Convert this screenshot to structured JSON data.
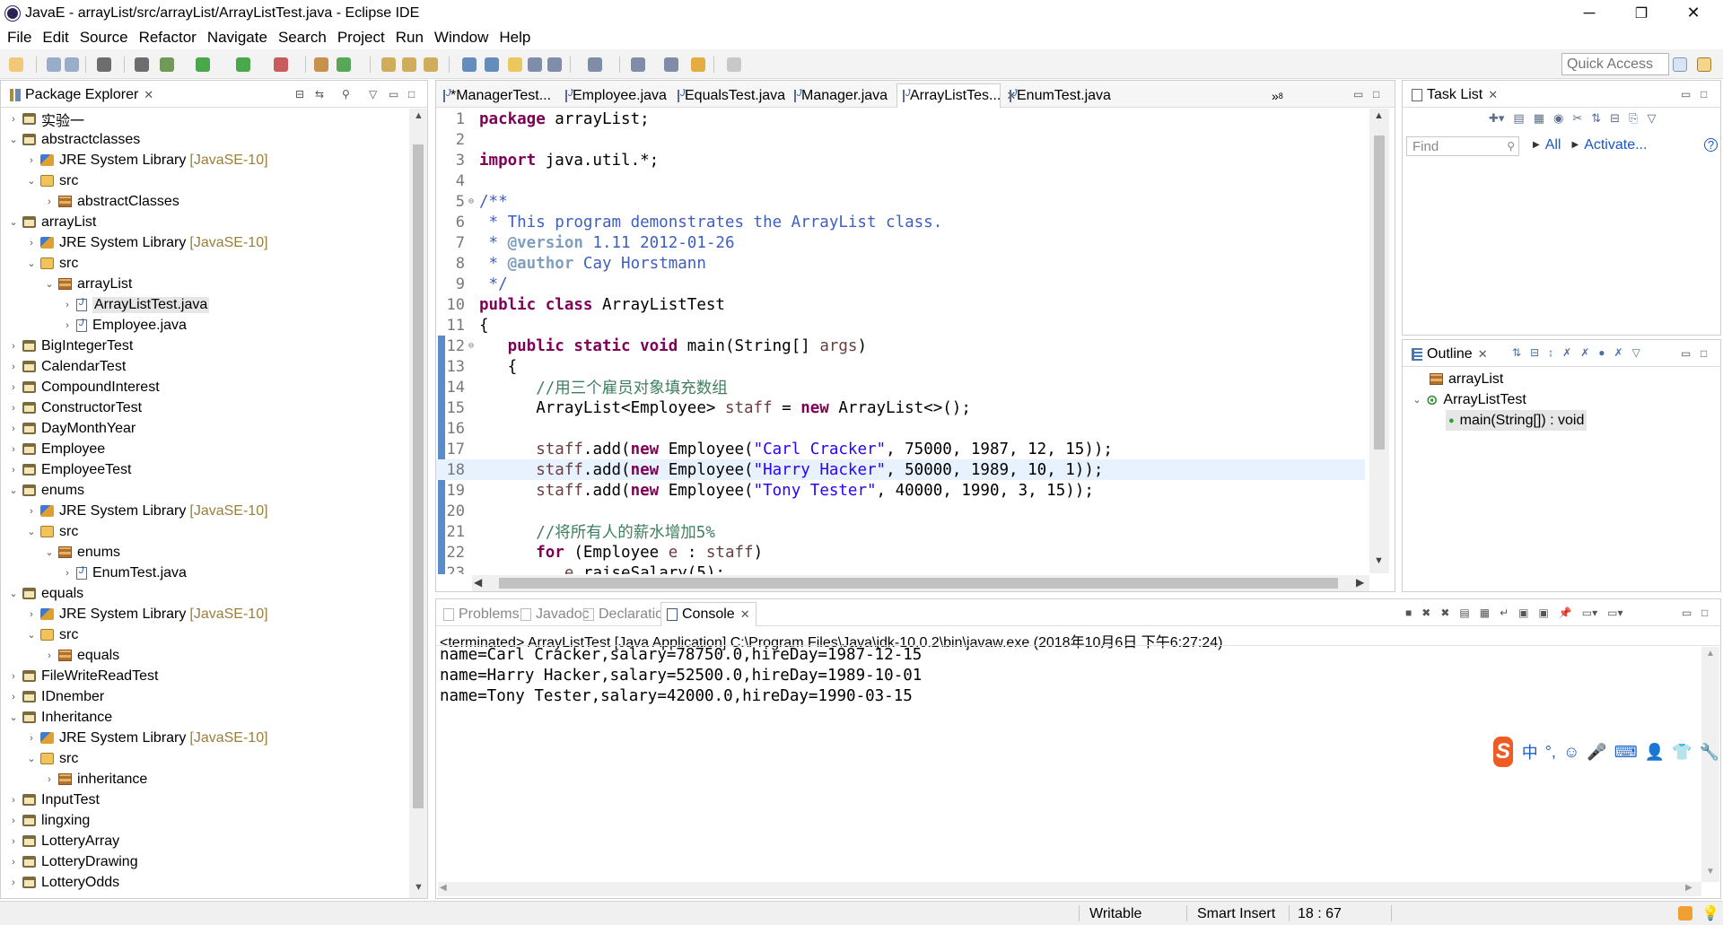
{
  "window": {
    "title": "JavaE - arrayList/src/arrayList/ArrayListTest.java - Eclipse IDE",
    "controls": {
      "minimize": "─",
      "restore": "❐",
      "close": "✕"
    }
  },
  "menu": [
    "File",
    "Edit",
    "Source",
    "Refactor",
    "Navigate",
    "Search",
    "Project",
    "Run",
    "Window",
    "Help"
  ],
  "toolbar": {
    "quick_access_placeholder": "Quick Access"
  },
  "package_explorer": {
    "title": "Package Explorer",
    "rows": [
      {
        "label": "实验一",
        "indent": 0,
        "expand": "›",
        "icon": "project",
        "extra": ""
      },
      {
        "label": "abstractclasses",
        "indent": 0,
        "expand": "⌄",
        "icon": "project",
        "extra": ""
      },
      {
        "label": "JRE System Library",
        "indent": 1,
        "expand": "›",
        "icon": "jre",
        "extra": "[JavaSE-10]"
      },
      {
        "label": "src",
        "indent": 1,
        "expand": "⌄",
        "icon": "src",
        "extra": ""
      },
      {
        "label": "abstractClasses",
        "indent": 2,
        "expand": "›",
        "icon": "pkg",
        "extra": ""
      },
      {
        "label": "arrayList",
        "indent": 0,
        "expand": "⌄",
        "icon": "project",
        "extra": ""
      },
      {
        "label": "JRE System Library",
        "indent": 1,
        "expand": "›",
        "icon": "jre",
        "extra": "[JavaSE-10]"
      },
      {
        "label": "src",
        "indent": 1,
        "expand": "⌄",
        "icon": "src",
        "extra": ""
      },
      {
        "label": "arrayList",
        "indent": 2,
        "expand": "⌄",
        "icon": "pkg",
        "extra": ""
      },
      {
        "label": "ArrayListTest.java",
        "indent": 3,
        "expand": "›",
        "icon": "java",
        "extra": "",
        "selected": true
      },
      {
        "label": "Employee.java",
        "indent": 3,
        "expand": "›",
        "icon": "java",
        "extra": ""
      },
      {
        "label": "BigIntegerTest",
        "indent": 0,
        "expand": "›",
        "icon": "project",
        "extra": ""
      },
      {
        "label": "CalendarTest",
        "indent": 0,
        "expand": "›",
        "icon": "project",
        "extra": ""
      },
      {
        "label": "CompoundInterest",
        "indent": 0,
        "expand": "›",
        "icon": "project",
        "extra": ""
      },
      {
        "label": "ConstructorTest",
        "indent": 0,
        "expand": "›",
        "icon": "project",
        "extra": ""
      },
      {
        "label": "DayMonthYear",
        "indent": 0,
        "expand": "›",
        "icon": "project",
        "extra": ""
      },
      {
        "label": "Employee",
        "indent": 0,
        "expand": "›",
        "icon": "project",
        "extra": ""
      },
      {
        "label": "EmployeeTest",
        "indent": 0,
        "expand": "›",
        "icon": "project",
        "extra": ""
      },
      {
        "label": "enums",
        "indent": 0,
        "expand": "⌄",
        "icon": "project",
        "extra": ""
      },
      {
        "label": "JRE System Library",
        "indent": 1,
        "expand": "›",
        "icon": "jre",
        "extra": "[JavaSE-10]"
      },
      {
        "label": "src",
        "indent": 1,
        "expand": "⌄",
        "icon": "src",
        "extra": ""
      },
      {
        "label": "enums",
        "indent": 2,
        "expand": "⌄",
        "icon": "pkg",
        "extra": ""
      },
      {
        "label": "EnumTest.java",
        "indent": 3,
        "expand": "›",
        "icon": "java",
        "extra": ""
      },
      {
        "label": "equals",
        "indent": 0,
        "expand": "⌄",
        "icon": "project",
        "extra": ""
      },
      {
        "label": "JRE System Library",
        "indent": 1,
        "expand": "›",
        "icon": "jre",
        "extra": "[JavaSE-10]"
      },
      {
        "label": "src",
        "indent": 1,
        "expand": "⌄",
        "icon": "src",
        "extra": ""
      },
      {
        "label": "equals",
        "indent": 2,
        "expand": "›",
        "icon": "pkg",
        "extra": ""
      },
      {
        "label": "FileWriteReadTest",
        "indent": 0,
        "expand": "›",
        "icon": "project",
        "extra": ""
      },
      {
        "label": "IDnember",
        "indent": 0,
        "expand": "›",
        "icon": "project",
        "extra": ""
      },
      {
        "label": "Inheritance",
        "indent": 0,
        "expand": "⌄",
        "icon": "project",
        "extra": ""
      },
      {
        "label": "JRE System Library",
        "indent": 1,
        "expand": "›",
        "icon": "jre",
        "extra": "[JavaSE-10]"
      },
      {
        "label": "src",
        "indent": 1,
        "expand": "⌄",
        "icon": "src",
        "extra": ""
      },
      {
        "label": "inheritance",
        "indent": 2,
        "expand": "›",
        "icon": "pkg",
        "extra": ""
      },
      {
        "label": "InputTest",
        "indent": 0,
        "expand": "›",
        "icon": "project",
        "extra": ""
      },
      {
        "label": "lingxing",
        "indent": 0,
        "expand": "›",
        "icon": "project",
        "extra": ""
      },
      {
        "label": "LotteryArray",
        "indent": 0,
        "expand": "›",
        "icon": "project",
        "extra": ""
      },
      {
        "label": "LotteryDrawing",
        "indent": 0,
        "expand": "›",
        "icon": "project",
        "extra": ""
      },
      {
        "label": "LotteryOdds",
        "indent": 0,
        "expand": "›",
        "icon": "project",
        "extra": ""
      }
    ]
  },
  "editor": {
    "tabs": [
      {
        "label": "*ManagerTest...",
        "active": false
      },
      {
        "label": "Employee.java",
        "active": false
      },
      {
        "label": "EqualsTest.java",
        "active": false
      },
      {
        "label": "Manager.java",
        "active": false
      },
      {
        "label": "ArrayListTes...",
        "active": true
      },
      {
        "label": "EnumTest.java",
        "active": false
      }
    ],
    "overflow_label": "»",
    "overflow_count": "8",
    "current_line": 18,
    "lines": [
      {
        "n": "1",
        "fold": "",
        "segs": [
          [
            "kw",
            "package"
          ],
          [
            "p",
            " arrayList;"
          ]
        ]
      },
      {
        "n": "2",
        "fold": "",
        "segs": []
      },
      {
        "n": "3",
        "fold": "",
        "segs": [
          [
            "kw",
            "import"
          ],
          [
            "p",
            " java.util.*;"
          ]
        ]
      },
      {
        "n": "4",
        "fold": "",
        "segs": []
      },
      {
        "n": "5",
        "fold": "⊖",
        "segs": [
          [
            "doc",
            "/**"
          ]
        ]
      },
      {
        "n": "6",
        "fold": "",
        "segs": [
          [
            "doc",
            " * This program demonstrates the ArrayList class."
          ]
        ]
      },
      {
        "n": "7",
        "fold": "",
        "segs": [
          [
            "doc",
            " * "
          ],
          [
            "tag",
            "@version"
          ],
          [
            "doc",
            " 1.11 2012-01-26"
          ]
        ]
      },
      {
        "n": "8",
        "fold": "",
        "segs": [
          [
            "doc",
            " * "
          ],
          [
            "tag",
            "@author"
          ],
          [
            "doc",
            " Cay Horstmann"
          ]
        ]
      },
      {
        "n": "9",
        "fold": "",
        "segs": [
          [
            "doc",
            " */"
          ]
        ]
      },
      {
        "n": "10",
        "fold": "",
        "segs": [
          [
            "kw",
            "public class"
          ],
          [
            "p",
            " ArrayListTest"
          ]
        ]
      },
      {
        "n": "11",
        "fold": "",
        "segs": [
          [
            "p",
            "{"
          ]
        ]
      },
      {
        "n": "12",
        "fold": "⊖",
        "segs": [
          [
            "p",
            "   "
          ],
          [
            "kw",
            "public static void"
          ],
          [
            "p",
            " main(String[] "
          ],
          [
            "var",
            "args"
          ],
          [
            "p",
            ")"
          ]
        ]
      },
      {
        "n": "13",
        "fold": "",
        "segs": [
          [
            "p",
            "   {"
          ]
        ]
      },
      {
        "n": "14",
        "fold": "",
        "segs": [
          [
            "p",
            "      "
          ],
          [
            "cmt",
            "//用三个雇员对象填充数组"
          ]
        ]
      },
      {
        "n": "15",
        "fold": "",
        "segs": [
          [
            "p",
            "      ArrayList<Employee> "
          ],
          [
            "var",
            "staff"
          ],
          [
            "p",
            " = "
          ],
          [
            "kw",
            "new"
          ],
          [
            "p",
            " ArrayList<>();"
          ]
        ]
      },
      {
        "n": "16",
        "fold": "",
        "segs": []
      },
      {
        "n": "17",
        "fold": "",
        "segs": [
          [
            "p",
            "      "
          ],
          [
            "var",
            "staff"
          ],
          [
            "p",
            ".add("
          ],
          [
            "kw",
            "new"
          ],
          [
            "p",
            " Employee("
          ],
          [
            "str",
            "\"Carl Cracker\""
          ],
          [
            "p",
            ", 75000, 1987, 12, 15));"
          ]
        ]
      },
      {
        "n": "18",
        "fold": "",
        "segs": [
          [
            "p",
            "      "
          ],
          [
            "var",
            "staff"
          ],
          [
            "p",
            ".add("
          ],
          [
            "kw",
            "new"
          ],
          [
            "p",
            " Employee("
          ],
          [
            "str",
            "\"Harry Hacker\""
          ],
          [
            "p",
            ", 50000, 1989, 10, 1));"
          ]
        ]
      },
      {
        "n": "19",
        "fold": "",
        "segs": [
          [
            "p",
            "      "
          ],
          [
            "var",
            "staff"
          ],
          [
            "p",
            ".add("
          ],
          [
            "kw",
            "new"
          ],
          [
            "p",
            " Employee("
          ],
          [
            "str",
            "\"Tony Tester\""
          ],
          [
            "p",
            ", 40000, 1990, 3, 15));"
          ]
        ]
      },
      {
        "n": "20",
        "fold": "",
        "segs": []
      },
      {
        "n": "21",
        "fold": "",
        "segs": [
          [
            "p",
            "      "
          ],
          [
            "cmt",
            "//将所有人的薪水增加5%"
          ]
        ]
      },
      {
        "n": "22",
        "fold": "",
        "segs": [
          [
            "p",
            "      "
          ],
          [
            "kw",
            "for"
          ],
          [
            "p",
            " (Employee "
          ],
          [
            "var",
            "e"
          ],
          [
            "p",
            " : "
          ],
          [
            "var",
            "staff"
          ],
          [
            "p",
            ")"
          ]
        ]
      },
      {
        "n": "23",
        "fold": "",
        "segs": [
          [
            "p",
            "         "
          ],
          [
            "var",
            "e"
          ],
          [
            "p",
            ".raiseSalary(5);"
          ]
        ]
      }
    ]
  },
  "task_list": {
    "title": "Task List",
    "find_placeholder": "Find",
    "all_label": "All",
    "activate_label": "Activate..."
  },
  "outline": {
    "title": "Outline",
    "items": [
      {
        "label": "arrayList",
        "icon": "pkg"
      },
      {
        "label": "ArrayListTest",
        "icon": "class"
      },
      {
        "label": "main(String[]) : void",
        "icon": "method"
      }
    ]
  },
  "bottom_tabs": [
    {
      "label": "Problems",
      "active": false
    },
    {
      "label": "Javadoc",
      "active": false
    },
    {
      "label": "Declaration",
      "active": false
    },
    {
      "label": "Console",
      "active": true
    }
  ],
  "console": {
    "header": "<terminated> ArrayListTest [Java Application] C:\\Program Files\\Java\\jdk-10.0.2\\bin\\javaw.exe (2018年10月6日 下午6:27:24)",
    "lines": [
      "name=Carl Cracker,salary=78750.0,hireDay=1987-12-15",
      "name=Harry Hacker,salary=52500.0,hireDay=1989-10-01",
      "name=Tony Tester,salary=42000.0,hireDay=1990-03-15"
    ]
  },
  "status_bar": {
    "writable": "Writable",
    "insert_mode": "Smart Insert",
    "position": "18 : 67"
  },
  "ime": {
    "logo": "S",
    "mode": "中",
    "punct": "°,",
    "emoji": "☺",
    "mic": "🎤",
    "keyboard": "⌨",
    "user": "👤",
    "shirt": "👕",
    "wrench": "🔧"
  },
  "colors": {
    "keyword": "#7f0055",
    "string": "#2a00ff",
    "comment": "#3f7f5f",
    "javadoc": "#3f5fbf",
    "current_line": "#e8f2fe",
    "ime_brand": "#f05a23"
  }
}
